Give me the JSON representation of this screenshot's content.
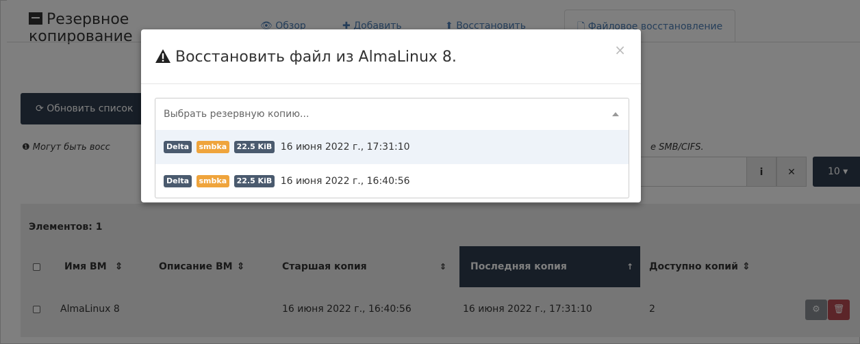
{
  "header": {
    "title": "Резервное копирование",
    "tabs": [
      {
        "label": "Обзор"
      },
      {
        "label": "Добавить"
      },
      {
        "label": "Восстановить"
      },
      {
        "label": "Файловое восстановление"
      }
    ]
  },
  "toolbar": {
    "refresh_label": "Обновить список",
    "info_text_left": "Могут быть восс",
    "info_text_right": "е SMB/CIFS.",
    "per_page": "10"
  },
  "table": {
    "count_label": "Элементов: 1",
    "columns": [
      "Имя ВМ",
      "Описание ВМ",
      "Старшая копия",
      "Последняя копия",
      "Доступно копий"
    ],
    "rows": [
      {
        "name": "AlmaLinux 8",
        "description": "",
        "oldest": "16 июня 2022 г., 16:40:56",
        "latest": "16 июня 2022 г., 17:31:10",
        "count": "2"
      }
    ]
  },
  "modal": {
    "title": "Восстановить файл из AlmaLinux 8.",
    "close_symbol": "×",
    "select_placeholder": "Выбрать резервную копию...",
    "options": [
      {
        "badge_type": "Delta",
        "badge_storage": "smbka",
        "badge_size": "22.5 KiB",
        "date": "16 июня 2022 г., 17:31:10"
      },
      {
        "badge_type": "Delta",
        "badge_storage": "smbka",
        "badge_size": "22.5 KiB",
        "date": "16 июня 2022 г., 16:40:56"
      }
    ]
  },
  "colors": {
    "dark_button": "#2f3d4e",
    "badge_dark": "#4a5a6e",
    "badge_orange": "#efa43c",
    "danger": "#b94b52",
    "overlay": "rgba(0,0,0,0.5)"
  }
}
